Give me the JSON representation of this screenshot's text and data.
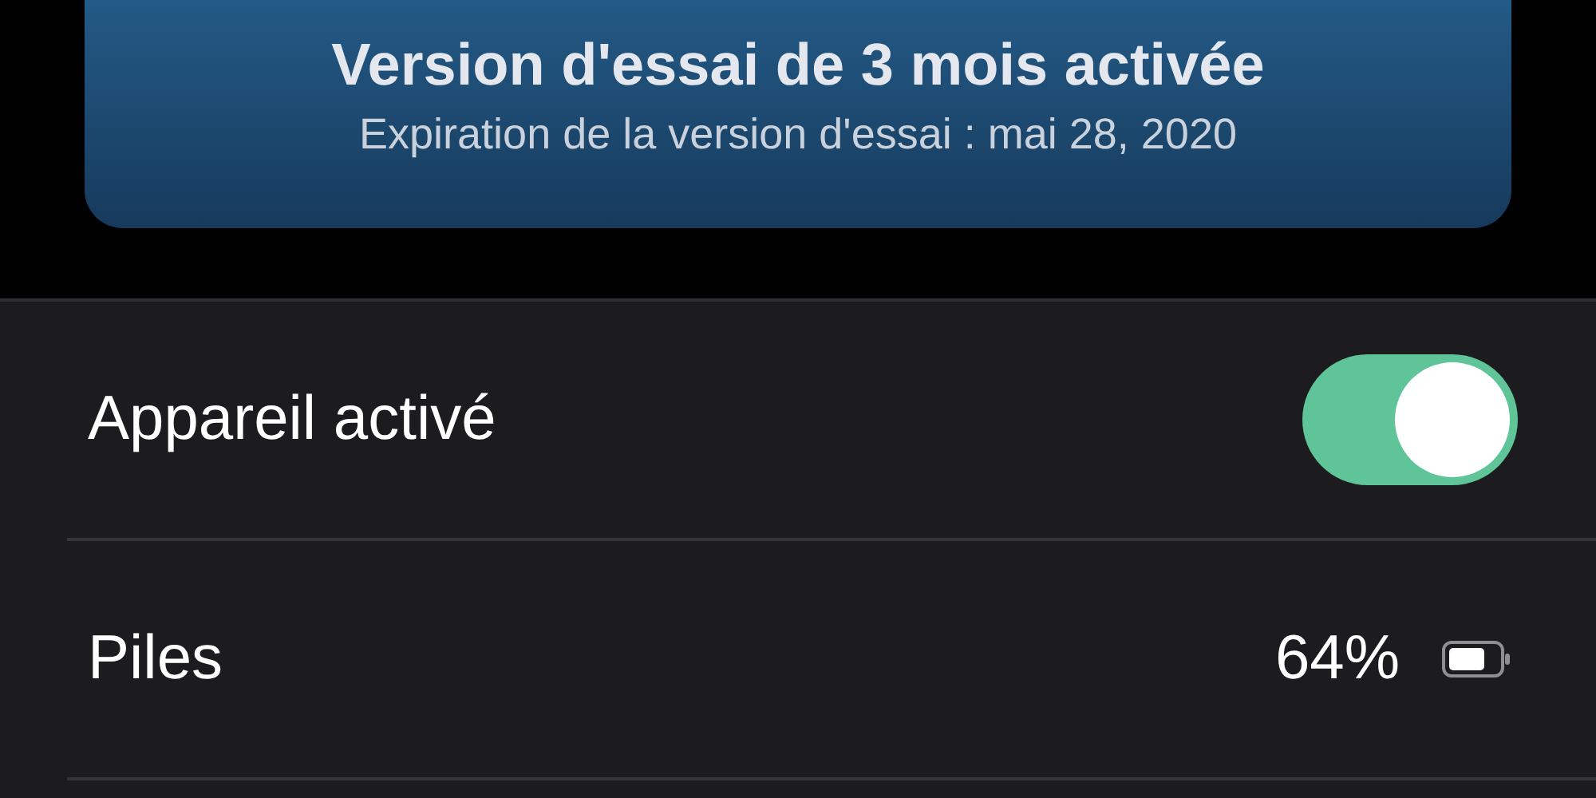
{
  "trial_banner": {
    "title": "Version d'essai de 3 mois activée",
    "subtitle": "Expiration de la version d'essai : mai 28, 2020"
  },
  "settings": [
    {
      "kind": "toggle",
      "label": "Appareil activé",
      "on": true
    },
    {
      "kind": "battery",
      "label": "Piles",
      "value": "64%"
    }
  ]
}
